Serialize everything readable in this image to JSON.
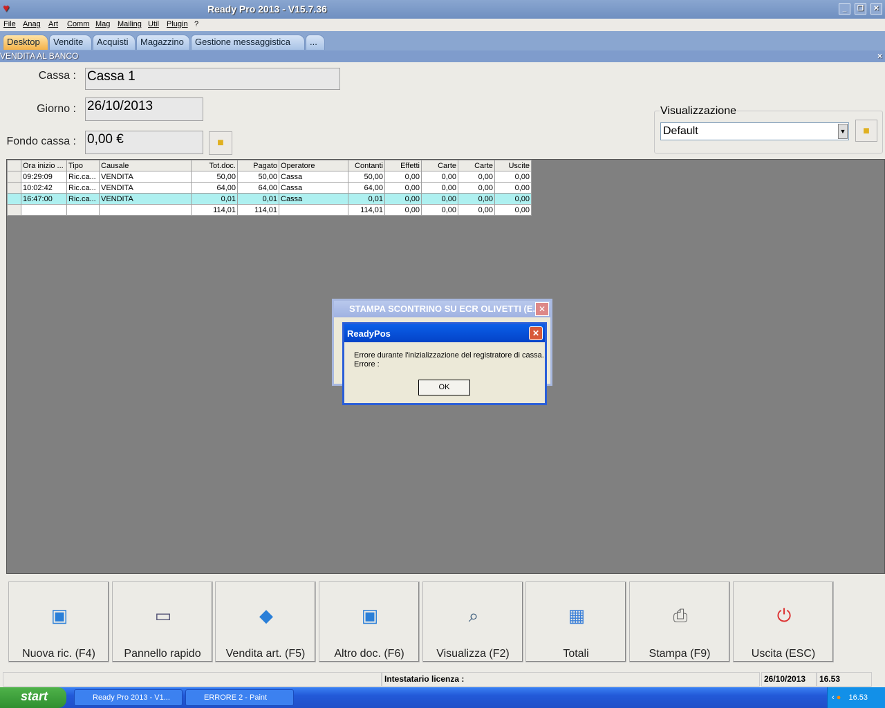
{
  "window": {
    "title": "Ready Pro 2013 - V15.7.36"
  },
  "menu": [
    "File",
    "Anag",
    "Art",
    "Comm",
    "Mag",
    "Mailing",
    "Util",
    "Plugin",
    "?"
  ],
  "tabs": [
    "Desktop",
    "Vendite",
    "Acquisti",
    "Magazzino",
    "Gestione messaggistica",
    "..."
  ],
  "panel": {
    "title": "VENDITA AL BANCO",
    "close": "×"
  },
  "form": {
    "cassa_label": "Cassa :",
    "cassa_value": "Cassa 1",
    "giorno_label": "Giorno :",
    "giorno_value": "26/10/2013",
    "fondo_label": "Fondo cassa :",
    "fondo_value": "0,00 €",
    "viz_label": "Visualizzazione",
    "viz_value": "Default"
  },
  "table": {
    "headers": [
      "Ora inizio ...",
      "Tipo",
      "Causale",
      "Tot.doc.",
      "Pagato",
      "Operatore",
      "Contanti",
      "Effetti",
      "Carte",
      "Carte",
      "Uscite"
    ],
    "rows": [
      [
        "09:29:09",
        "Ric.ca...",
        "VENDITA",
        "50,00",
        "50,00",
        "Cassa",
        "50,00",
        "0,00",
        "0,00",
        "0,00",
        "0,00"
      ],
      [
        "10:02:42",
        "Ric.ca...",
        "VENDITA",
        "64,00",
        "64,00",
        "Cassa",
        "64,00",
        "0,00",
        "0,00",
        "0,00",
        "0,00"
      ],
      [
        "16:47:00",
        "Ric.ca...",
        "VENDITA",
        "0,01",
        "0,01",
        "Cassa",
        "0,01",
        "0,00",
        "0,00",
        "0,00",
        "0,00"
      ]
    ],
    "totals": [
      "",
      "",
      "",
      "114,01",
      "114,01",
      "",
      "114,01",
      "0,00",
      "0,00",
      "0,00",
      "0,00"
    ]
  },
  "bg_dialog": {
    "title": "STAMPA SCONTRINO SU ECR OLIVETTI (E..."
  },
  "error_dialog": {
    "title": "ReadyPos",
    "line1": "Errore durante l'inizializzazione del registratore di cassa.",
    "line2": "Errore :",
    "ok": "OK"
  },
  "buttons": [
    {
      "label": "Nuova ric. (F4)",
      "icon": "box-add-icon"
    },
    {
      "label": "Pannello rapido",
      "icon": "monitor-icon"
    },
    {
      "label": "Vendita art. (F5)",
      "icon": "cube-add-icon"
    },
    {
      "label": "Altro doc. (F6)",
      "icon": "box-add-icon"
    },
    {
      "label": "Visualizza (F2)",
      "icon": "magnifier-icon"
    },
    {
      "label": "Totali",
      "icon": "calculator-icon"
    },
    {
      "label": "Stampa (F9)",
      "icon": "printer-icon"
    },
    {
      "label": "Uscita (ESC)",
      "icon": "power-icon"
    }
  ],
  "status": {
    "license": "Intestatario licenza :",
    "date": "26/10/2013",
    "time": "16.53"
  },
  "taskbar": {
    "start": "start",
    "tasks": [
      "Ready Pro 2013 - V1...",
      "ERRORE 2 - Paint"
    ],
    "clock": "16.53"
  }
}
